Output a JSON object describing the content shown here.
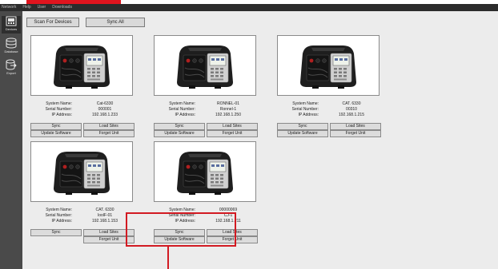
{
  "menu": [
    "Network",
    "Help",
    "User",
    "Downloads"
  ],
  "sidebar": [
    {
      "label": "Devices",
      "icon": "devices-icon"
    },
    {
      "label": "Database",
      "icon": "database-icon"
    },
    {
      "label": "Export",
      "icon": "export-icon"
    }
  ],
  "toolbar": {
    "scan_label": "Scan For Devices",
    "sync_all_label": "Sync All"
  },
  "field_labels": {
    "system_name": "System Name:",
    "serial_number": "Serial Number:",
    "ip_address": "IP Address:"
  },
  "devices": [
    {
      "system_name": "Cat-6330",
      "serial_number": "000001",
      "ip_address": "192.168.1.233",
      "buttons": [
        "Sync",
        "Load Sites",
        "Update Software",
        "Forget Unit"
      ]
    },
    {
      "system_name": "RONNEL-01",
      "serial_number": "Ronnel-1",
      "ip_address": "192.168.1.250",
      "buttons": [
        "Sync",
        "Load Sites",
        "Update Software",
        "Forget Unit"
      ]
    },
    {
      "system_name": "CAT. 6330",
      "serial_number": "00310",
      "ip_address": "192.168.1.215",
      "buttons": [
        "Sync",
        "Load Sites",
        "Update Software",
        "Forget Unit"
      ]
    },
    {
      "system_name": "CAT. 6330",
      "serial_number": "IoolF-01",
      "ip_address": "192.168.1.153",
      "buttons": [
        "Sync",
        "Load Sites",
        "",
        "Forget Unit"
      ]
    },
    {
      "system_name": "00000069",
      "serial_number": "CJ-1",
      "ip_address": "192.168.1.211",
      "buttons": [
        "Sync",
        "Load Sites",
        "Update Software",
        "Forget Unit"
      ]
    }
  ]
}
